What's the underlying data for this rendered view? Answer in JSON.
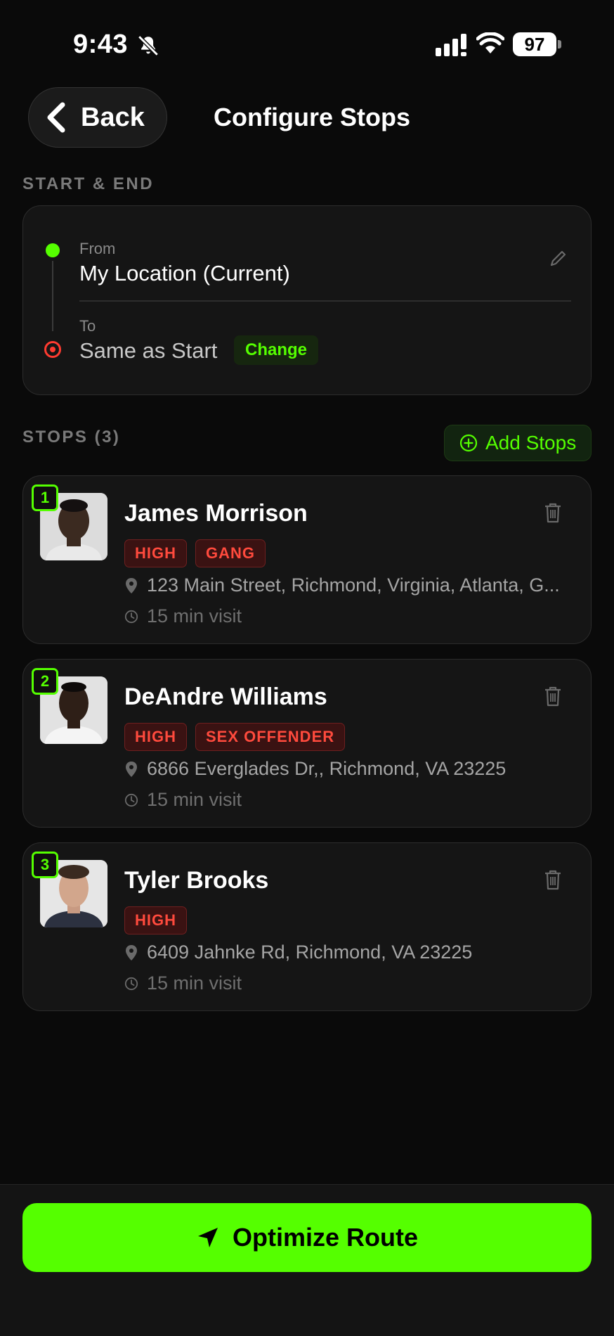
{
  "status_bar": {
    "time": "9:43",
    "battery": "97"
  },
  "header": {
    "back_label": "Back",
    "title": "Configure Stops"
  },
  "route": {
    "section_label": "START & END",
    "from_label": "From",
    "from_value": "My Location (Current)",
    "to_label": "To",
    "to_value": "Same as Start",
    "change_label": "Change"
  },
  "stops_section": {
    "label": "STOPS (3)",
    "add_label": "Add Stops"
  },
  "stops": [
    {
      "number": "1",
      "name": "James Morrison",
      "tags": [
        "HIGH",
        "GANG"
      ],
      "address": "123 Main Street, Richmond, Virginia, Atlanta, G...",
      "visit": "15 min visit"
    },
    {
      "number": "2",
      "name": "DeAndre Williams",
      "tags": [
        "HIGH",
        "SEX OFFENDER"
      ],
      "address": "6866 Everglades Dr,, Richmond, VA 23225",
      "visit": "15 min visit"
    },
    {
      "number": "3",
      "name": "Tyler Brooks",
      "tags": [
        "HIGH"
      ],
      "address": "6409 Jahnke Rd, Richmond, VA 23225",
      "visit": "15 min visit"
    }
  ],
  "footer": {
    "optimize_label": "Optimize Route"
  },
  "colors": {
    "accent": "#55ff00",
    "danger": "#ff4a3d",
    "background": "#0a0a0a"
  },
  "icons": [
    "bell-slash-icon",
    "signal-icon",
    "wifi-icon",
    "chevron-left-icon",
    "pencil-icon",
    "plus-circle-icon",
    "trash-icon",
    "map-pin-icon",
    "clock-icon",
    "navigation-arrow-icon"
  ]
}
